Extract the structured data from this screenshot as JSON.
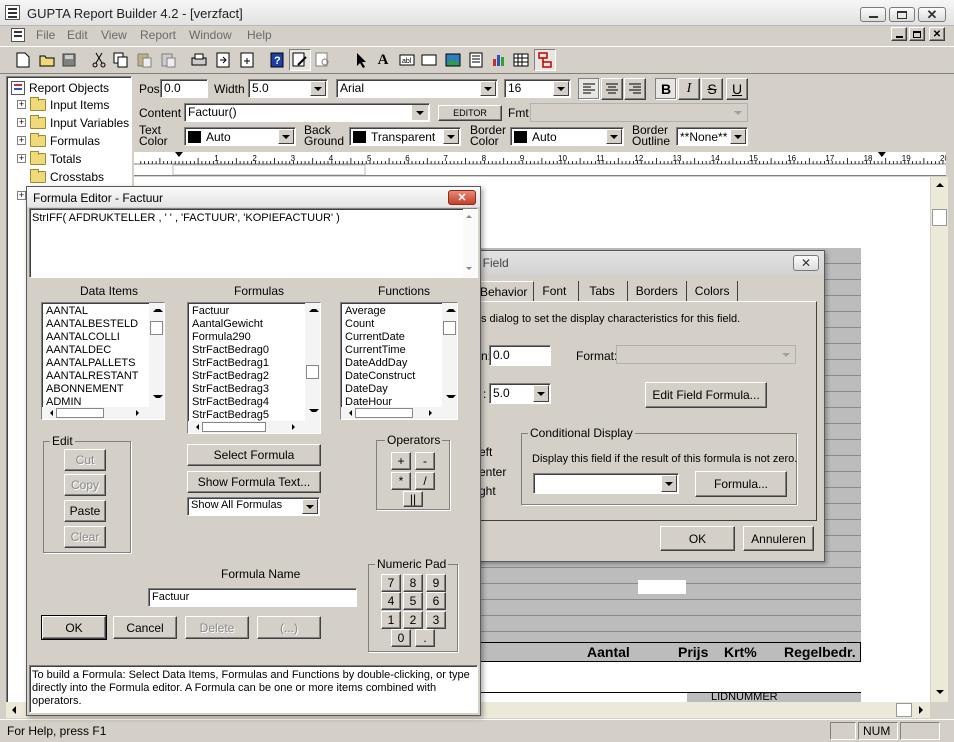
{
  "app": {
    "title": "GUPTA Report Builder 4.2 - [verzfact]",
    "menu": [
      "File",
      "Edit",
      "View",
      "Report",
      "Window",
      "Help"
    ],
    "status_left": "For Help, press F1",
    "status_num": "NUM"
  },
  "tree": {
    "root": "Report Objects",
    "items": [
      "Input Items",
      "Input Variables",
      "Formulas",
      "Totals",
      "Crosstabs"
    ]
  },
  "props": {
    "pos_label": "Pos",
    "pos_value": "0.0",
    "width_label": "Width",
    "width_value": "5.0",
    "font_value": "Arial",
    "size_value": "16",
    "content_label": "Content",
    "content_value": "Factuur()",
    "editor_label": "EDITOR",
    "fmt_label": "Fmt",
    "text_color_label": [
      "Text",
      "Color"
    ],
    "text_color_value": "Auto",
    "back_ground_label": [
      "Back",
      "Ground"
    ],
    "back_ground_value": "Transparent",
    "border_color_label": [
      "Border",
      "Color"
    ],
    "border_color_value": "Auto",
    "border_outline_label": [
      "Border",
      "Outline"
    ],
    "border_outline_value": "**None**",
    "bold": "B",
    "italic": "I",
    "strike": "S",
    "underline": "U"
  },
  "ruler": [
    "1",
    "2",
    "3",
    "4",
    "5",
    "6",
    "7",
    "8",
    "9",
    "10",
    "11",
    "12",
    "13",
    "14",
    "15",
    "16",
    "17",
    "18",
    "19",
    "20"
  ],
  "report": {
    "headers": [
      "Aantal",
      "Prijs",
      "Krt%",
      "Regelbedr."
    ],
    "bottom_label": "LIDNUMMER"
  },
  "field_dialog": {
    "title": ": Field",
    "tabs": [
      "Behavior",
      "Font",
      "Tabs",
      "Borders",
      "Colors"
    ],
    "description": "s dialog to set the display characteristics for this field.",
    "pos_label": "n:",
    "pos_value": "0.0",
    "format_label": "Format:",
    "width_label": ":",
    "width_value": "5.0",
    "edit_field_formula": "Edit Field  Formula...",
    "align_labels": [
      "eft",
      "enter",
      "ght"
    ],
    "cond_group": "Conditional Display",
    "cond_text": "Display this field if the result of this formula is not zero.",
    "formula_button": "Formula...",
    "ok": "OK",
    "cancel": "Annuleren"
  },
  "formula_editor": {
    "title": "Formula Editor - Factuur",
    "formula_text": "StrIFF( AFDRUKTELLER , ' ' , 'FACTUUR', 'KOPIEFACTUUR' )",
    "data_items_label": "Data Items",
    "formulas_label": "Formulas",
    "functions_label": "Functions",
    "data_items": [
      "AANTAL",
      "AANTALBESTELD",
      "AANTALCOLLI",
      "AANTALDEC",
      "AANTALPALLETS",
      "AANTALRESTANT",
      "ABONNEMENT",
      "ADMIN"
    ],
    "formulas": [
      "Factuur",
      "AantalGewicht",
      "Formula290",
      "StrFactBedrag0",
      "StrFactBedrag1",
      "StrFactBedrag2",
      "StrFactBedrag3",
      "StrFactBedrag4",
      "StrFactBedrag5"
    ],
    "functions": [
      "Average",
      "Count",
      "CurrentDate",
      "CurrentTime",
      "DateAddDay",
      "DateConstruct",
      "DateDay",
      "DateHour"
    ],
    "edit_group": "Edit",
    "cut": "Cut",
    "copy": "Copy",
    "paste": "Paste",
    "clear": "Clear",
    "select_formula": "Select Formula",
    "show_formula_text": "Show Formula Text...",
    "show_all_formulas": "Show All Formulas",
    "operators_group": "Operators",
    "operators": [
      "+",
      "-",
      "*",
      "/",
      "||"
    ],
    "formula_name_label": "Formula Name",
    "formula_name_value": "Factuur",
    "numeric_pad_group": "Numeric Pad",
    "numpad": [
      "7",
      "8",
      "9",
      "4",
      "5",
      "6",
      "1",
      "2",
      "3",
      "0",
      "."
    ],
    "ok": "OK",
    "cancel": "Cancel",
    "delete": "Delete",
    "ellipsis": "(...)",
    "help_text": "To build a Formula: Select Data Items, Formulas and Functions by double-clicking, or type directly into the Formula editor. A Formula can be one or more items combined with operators."
  }
}
